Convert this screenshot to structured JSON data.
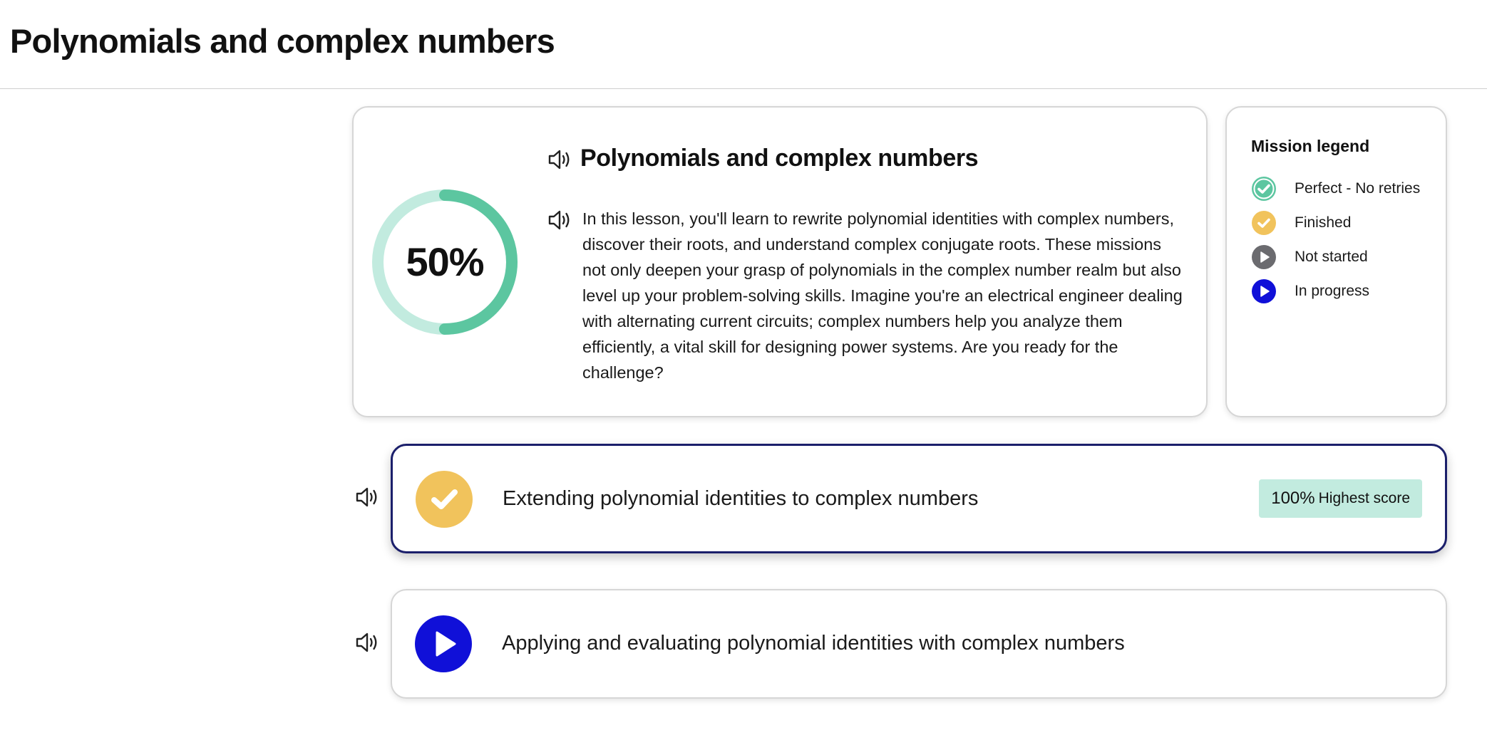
{
  "page": {
    "title": "Polynomials and complex numbers"
  },
  "lesson": {
    "title": "Polynomials and complex numbers",
    "description": "In this lesson, you'll learn to rewrite polynomial identities with complex numbers, discover their roots, and understand complex conjugate roots. These missions not only deepen your grasp of polynomials in the complex number realm but also level up your problem-solving skills. Imagine you're an electrical engineer dealing with alternating current circuits; complex numbers help you analyze them efficiently, a vital skill for designing power systems. Are you ready for the challenge?",
    "progress_label": "50%",
    "progress_fraction": 0.5,
    "ring_colors": {
      "track": "#c2ebdf",
      "fill": "#5cc6a0"
    },
    "icons": {
      "speaker": "speaker-icon"
    }
  },
  "legend": {
    "title": "Mission legend",
    "items": [
      {
        "label": "Perfect - No retries",
        "icon": "perfect-check-icon",
        "color": "#5cc6a0"
      },
      {
        "label": "Finished",
        "icon": "finished-check-icon",
        "color": "#f1c35c"
      },
      {
        "label": "Not started",
        "icon": "not-started-play-icon",
        "color": "#6b6b6f"
      },
      {
        "label": "In progress",
        "icon": "in-progress-play-icon",
        "color": "#1010d8"
      }
    ]
  },
  "missions": [
    {
      "label": "Extending polynomial identities to complex numbers",
      "status": "finished",
      "icon": "finished-check-icon",
      "icon_color": "#f1c35c",
      "score_value": "100%",
      "score_text": "Highest score",
      "selected": true
    },
    {
      "label": "Applying and evaluating polynomial identities with complex numbers",
      "status": "in-progress",
      "icon": "in-progress-play-icon",
      "icon_color": "#1010d8",
      "selected": false
    }
  ]
}
